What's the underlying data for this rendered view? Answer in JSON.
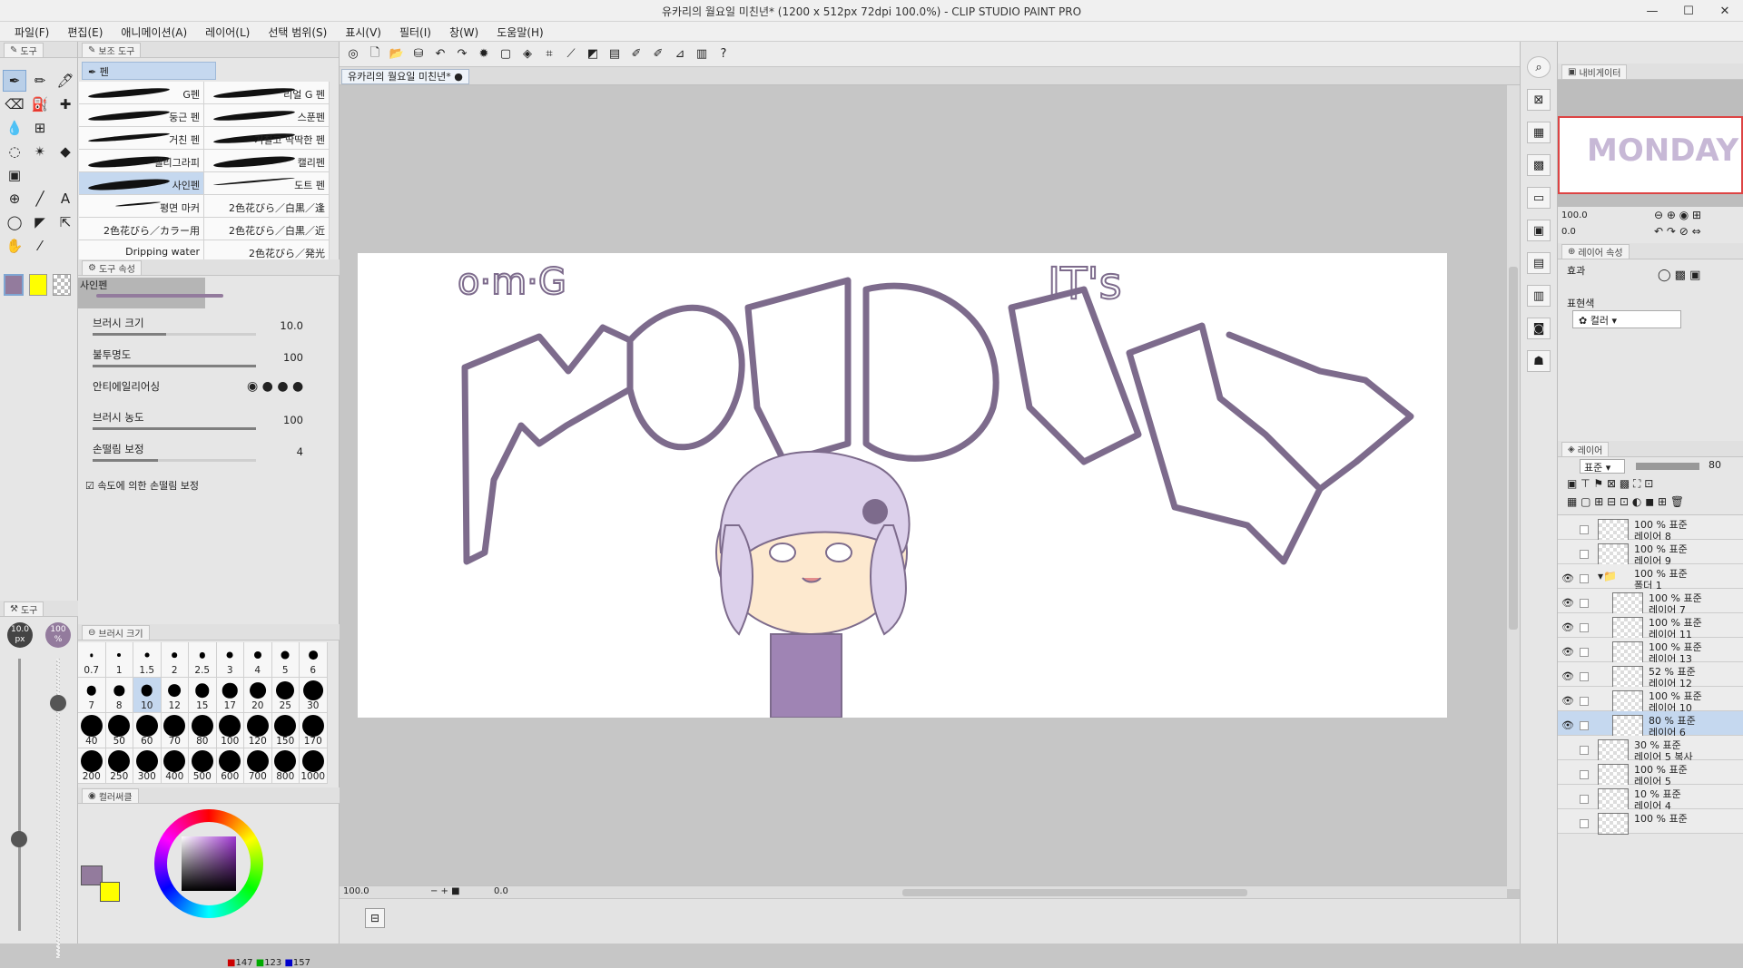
{
  "window": {
    "title": "유카리의 월요일 미친년* (1200 x 512px 72dpi 100.0%)  - CLIP STUDIO PAINT PRO",
    "controls": [
      "—",
      "☐",
      "✕"
    ]
  },
  "menu": [
    "파일(F)",
    "편집(E)",
    "애니메이션(A)",
    "레이어(L)",
    "선택 범위(S)",
    "표시(V)",
    "필터(I)",
    "창(W)",
    "도움말(H)"
  ],
  "tool_panel": {
    "tab": "도구",
    "tools": [
      "pen-tool",
      "pencil-tool",
      "marker-tool",
      "eraser-tool",
      "blend-tool",
      "sparkle-tool",
      "drop-tool",
      "grid-tool",
      "plus-tool",
      "lasso-tool",
      "magic-wand-tool",
      "fill-tool",
      "gradient-tool",
      "blank",
      "blank",
      "transform-tool",
      "line-tool",
      "text-tool",
      "balloon-tool",
      "ruler-tool",
      "select-obj-tool",
      "hand-tool",
      "eyedropper-tool",
      "blank"
    ]
  },
  "sub_tool": {
    "tab": "보조 도구",
    "group": "펜",
    "brushes": [
      {
        "name": "G펜",
        "selected": false
      },
      {
        "name": "리얼 G 펜",
        "selected": false
      },
      {
        "name": "둥근 펜",
        "selected": false
      },
      {
        "name": "스푼펜",
        "selected": false
      },
      {
        "name": "거친 펜",
        "selected": false
      },
      {
        "name": "거칠고 딱딱한 펜",
        "selected": false
      },
      {
        "name": "캘리그라피",
        "selected": false
      },
      {
        "name": "캘리펜",
        "selected": false
      },
      {
        "name": "사인펜",
        "selected": true
      },
      {
        "name": "도트 펜",
        "selected": false
      },
      {
        "name": "평면 마커",
        "selected": false
      },
      {
        "name": "2色花びら／白黒／逢",
        "selected": false
      },
      {
        "name": "2色花びら／カラー用",
        "selected": false
      },
      {
        "name": "2色花びら／白黒／近",
        "selected": false
      },
      {
        "name": "Dripping water",
        "selected": false
      },
      {
        "name": "2色花びら／発光",
        "selected": false
      }
    ]
  },
  "tool_property": {
    "tab": "도구 속성",
    "brush_name": "사인펜",
    "rows": [
      {
        "label": "브러시 크기",
        "value": "10.0",
        "fill": 0.45
      },
      {
        "label": "불투명도",
        "value": "100",
        "fill": 1.0
      },
      {
        "label": "안티에일리어싱",
        "value": "",
        "fill": 0
      },
      {
        "label": "브러시 농도",
        "value": "100",
        "fill": 1.0
      },
      {
        "label": "손떨림 보정",
        "value": "4",
        "fill": 0.4
      }
    ],
    "checkbox_label": "속도에 의한 손떨림 보정"
  },
  "left_small": {
    "tab": "도구",
    "size_value": "10.0",
    "size_unit": "px",
    "opacity_value": "100",
    "opacity_unit": "%"
  },
  "brush_size": {
    "tab": "브러시 크기",
    "sizes": [
      "0.7",
      "1",
      "1.5",
      "2",
      "2.5",
      "3",
      "4",
      "5",
      "6",
      "7",
      "8",
      "10",
      "12",
      "15",
      "17",
      "20",
      "25",
      "30",
      "40",
      "50",
      "60",
      "70",
      "80",
      "100",
      "120",
      "150",
      "170",
      "200",
      "250",
      "300",
      "400",
      "500",
      "600",
      "700",
      "800",
      "1000"
    ],
    "selected": "10"
  },
  "color_wheel": {
    "tab": "컬러써클",
    "r": "147",
    "g": "123",
    "b": "157",
    "main_color": "#937b9d",
    "sub_color": "#ffff00"
  },
  "document": {
    "tab": "유카리의 월요일 미친년*",
    "zoom": "100.0",
    "rotation": "0.0"
  },
  "canvas_art": {
    "text_omg": "o·m·G",
    "text_its": "IT's",
    "text_main": "MONDAY"
  },
  "navigator": {
    "tab": "내비게이터",
    "zoom": "100.0",
    "rotation": "0.0"
  },
  "layer_property": {
    "tab": "레이어 속성",
    "effect_label": "효과",
    "expression_label": "표현색",
    "expression_value": "컬러"
  },
  "layers_panel": {
    "tab": "레이어",
    "blend_mode": "표준",
    "opacity": "80",
    "layers": [
      {
        "opacity": "100 %",
        "mode": "표준",
        "name": "레이어 8",
        "visible": false,
        "indent": 0,
        "folder": false,
        "selected": false
      },
      {
        "opacity": "100 %",
        "mode": "표준",
        "name": "레이어 9",
        "visible": false,
        "indent": 0,
        "folder": false,
        "selected": false
      },
      {
        "opacity": "100 %",
        "mode": "표준",
        "name": "폴더 1",
        "visible": true,
        "indent": 0,
        "folder": true,
        "selected": false
      },
      {
        "opacity": "100 %",
        "mode": "표준",
        "name": "레이어 7",
        "visible": true,
        "indent": 1,
        "folder": false,
        "selected": false
      },
      {
        "opacity": "100 %",
        "mode": "표준",
        "name": "레이어 11",
        "visible": true,
        "indent": 1,
        "folder": false,
        "selected": false
      },
      {
        "opacity": "100 %",
        "mode": "표준",
        "name": "레이어 13",
        "visible": true,
        "indent": 1,
        "folder": false,
        "selected": false
      },
      {
        "opacity": "52 %",
        "mode": "표준",
        "name": "레이어 12",
        "visible": true,
        "indent": 1,
        "folder": false,
        "selected": false
      },
      {
        "opacity": "100 %",
        "mode": "표준",
        "name": "레이어 10",
        "visible": true,
        "indent": 1,
        "folder": false,
        "selected": false
      },
      {
        "opacity": "80 %",
        "mode": "표준",
        "name": "레이어 6",
        "visible": true,
        "indent": 1,
        "folder": false,
        "selected": true
      },
      {
        "opacity": "30 %",
        "mode": "표준",
        "name": "레이어 5 복사",
        "visible": false,
        "indent": 0,
        "folder": false,
        "selected": false
      },
      {
        "opacity": "100 %",
        "mode": "표준",
        "name": "레이어 5",
        "visible": false,
        "indent": 0,
        "folder": false,
        "selected": false
      },
      {
        "opacity": "10 %",
        "mode": "표준",
        "name": "레이어 4",
        "visible": false,
        "indent": 0,
        "folder": false,
        "selected": false
      },
      {
        "opacity": "100 %",
        "mode": "표준",
        "name": "",
        "visible": false,
        "indent": 0,
        "folder": false,
        "selected": false
      }
    ]
  },
  "colors": {
    "accent": "#c5d8ef",
    "art_outline": "#7d6b8c",
    "hair": "#dcd0eb",
    "skin": "#fde9cf",
    "dress": "#9f84b4"
  }
}
